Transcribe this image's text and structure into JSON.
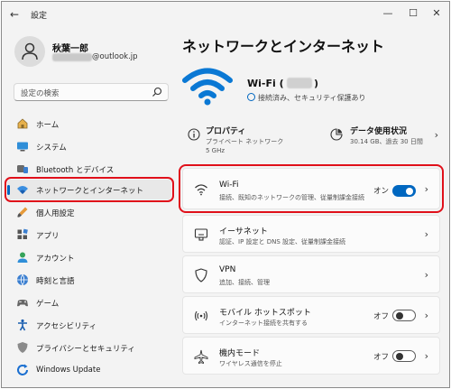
{
  "window": {
    "title": "設定",
    "controls": {
      "minimize": "—",
      "maximize": "☐",
      "close": "✕"
    }
  },
  "user": {
    "name": "秋葉一郎",
    "email_domain": "@outlook.jp"
  },
  "search": {
    "placeholder": "設定の検索"
  },
  "sidebar": {
    "items": [
      {
        "label": "ホーム",
        "icon": "home-icon"
      },
      {
        "label": "システム",
        "icon": "system-icon"
      },
      {
        "label": "Bluetooth とデバイス",
        "icon": "bluetooth-icon"
      },
      {
        "label": "ネットワークとインターネット",
        "icon": "network-icon",
        "selected": true
      },
      {
        "label": "個人用設定",
        "icon": "brush-icon"
      },
      {
        "label": "アプリ",
        "icon": "apps-icon"
      },
      {
        "label": "アカウント",
        "icon": "account-icon"
      },
      {
        "label": "時刻と言語",
        "icon": "time-language-icon"
      },
      {
        "label": "ゲーム",
        "icon": "gaming-icon"
      },
      {
        "label": "アクセシビリティ",
        "icon": "accessibility-icon"
      },
      {
        "label": "プライバシーとセキュリティ",
        "icon": "shield-icon"
      },
      {
        "label": "Windows Update",
        "icon": "update-icon"
      }
    ]
  },
  "main": {
    "title": "ネットワークとインターネット",
    "wifi_header": {
      "name_prefix": "Wi-Fi (",
      "name_suffix": ")",
      "status": "接続済み、セキュリティ保護あり"
    },
    "properties": {
      "title": "プロパティ",
      "line1": "プライベート ネットワーク",
      "line2": "5 GHz"
    },
    "data_usage": {
      "title": "データ使用状況",
      "detail": "30.14 GB、過去 30 日間"
    },
    "cards": [
      {
        "title": "Wi-Fi",
        "subtitle": "接続、既知のネットワークの管理、従量制課金接続",
        "state": "オン",
        "toggle": "on",
        "icon": "wifi-icon"
      },
      {
        "title": "イーサネット",
        "subtitle": "認証、IP 設定と DNS 設定、従量制課金接続",
        "icon": "ethernet-icon"
      },
      {
        "title": "VPN",
        "subtitle": "追加、接続、管理",
        "icon": "vpn-shield-icon"
      },
      {
        "title": "モバイル ホットスポット",
        "subtitle": "インターネット接続を共有する",
        "state": "オフ",
        "toggle": "off",
        "icon": "hotspot-icon"
      },
      {
        "title": "機内モード",
        "subtitle": "ワイヤレス通信を停止",
        "state": "オフ",
        "toggle": "off",
        "icon": "airplane-icon"
      }
    ],
    "chevron": "›"
  },
  "colors": {
    "accent": "#0067c0",
    "highlight": "#e0101a",
    "background": "#f3f3f3",
    "card": "#fbfbfb"
  }
}
